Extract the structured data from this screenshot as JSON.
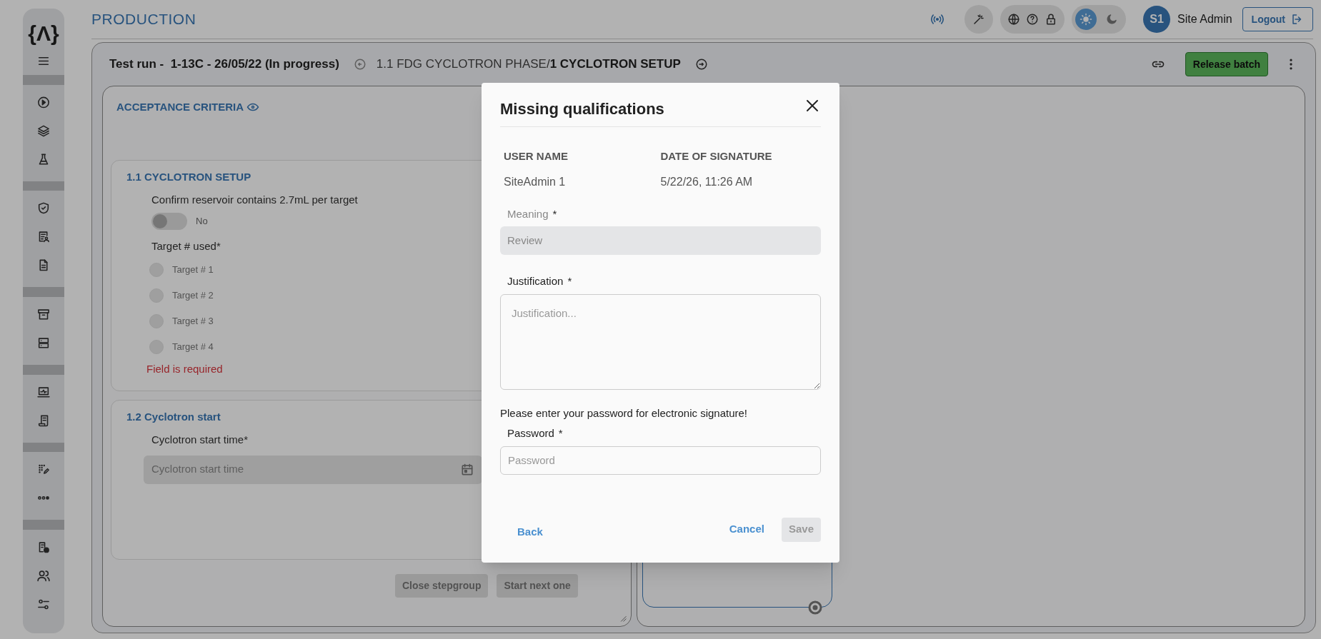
{
  "sidebar": {
    "logo": "{Λ}"
  },
  "header": {
    "title": "PRODUCTION",
    "theme": [
      {
        "kind": "light",
        "selected": true
      },
      {
        "kind": "dark",
        "selected": false
      }
    ],
    "user": {
      "initials": "S1",
      "name": "Site Admin"
    },
    "logout": "Logout"
  },
  "run": {
    "title": "Test run -  1-13C - 26/05/22 (In progress)",
    "phase": "1.1 FDG CYCLOTRON PHASE/",
    "step": "1 CYCLOTRON SETUP",
    "release": "Release batch"
  },
  "criteria": {
    "title": "ACCEPTANCE CRITERIA",
    "stepgroups": [
      {
        "title": "1.1 CYCLOTRON SETUP",
        "fields": [
          {
            "kind": "toggle",
            "label": "Confirm reservoir contains 2.7mL per target",
            "on": false,
            "value": "No"
          },
          {
            "kind": "radio",
            "label": "Target # used*",
            "options": [
              {
                "label": "Target # 1",
                "selected": false
              },
              {
                "label": "Target # 2",
                "selected": false
              },
              {
                "label": "Target # 3",
                "selected": false
              },
              {
                "label": "Target # 4",
                "selected": false
              }
            ],
            "error": "Field is required"
          }
        ]
      },
      {
        "title": "1.2 Cyclotron start",
        "fields": [
          {
            "kind": "date",
            "label": "Cyclotron start time*",
            "placeholder": "Cyclotron start time"
          }
        ]
      }
    ],
    "buttons": [
      "Close stepgroup",
      "Start next one"
    ]
  },
  "modal": {
    "title": "Missing qualifications",
    "columns": [
      {
        "heading": "USER NAME",
        "value": "SiteAdmin 1"
      },
      {
        "heading": "DATE OF SIGNATURE",
        "value": "5/22/26, 11:26 AM"
      }
    ],
    "meaning": {
      "label": "Meaning",
      "mark": "*",
      "value": "Review",
      "disabled": true
    },
    "justification": {
      "label": "Justification",
      "mark": "*",
      "placeholder": "Justification..."
    },
    "note": "Please enter your password for electronic signature!",
    "password": {
      "label": "Password",
      "mark": "*",
      "placeholder": "Password"
    },
    "back": "Back",
    "cancel": "Cancel",
    "save": {
      "label": "Save",
      "disabled": true
    }
  }
}
